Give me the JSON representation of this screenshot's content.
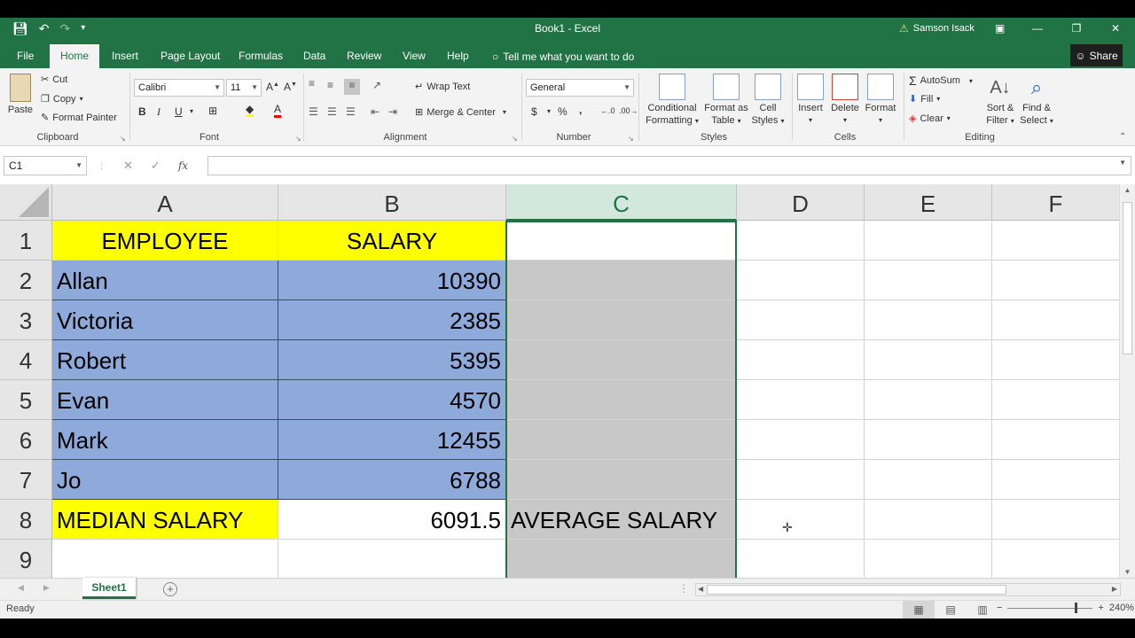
{
  "titlebar": {
    "title": "Book1  -  Excel",
    "user": "Samson Isack"
  },
  "tabs": [
    "File",
    "Home",
    "Insert",
    "Page Layout",
    "Formulas",
    "Data",
    "Review",
    "View",
    "Help"
  ],
  "tell_me": "Tell me what you want to do",
  "share": "Share",
  "ribbon": {
    "clipboard": {
      "paste": "Paste",
      "cut": "Cut",
      "copy": "Copy",
      "format_painter": "Format Painter",
      "label": "Clipboard"
    },
    "font": {
      "name": "Calibri",
      "size": "11",
      "bold": "B",
      "italic": "I",
      "underline": "U",
      "label": "Font"
    },
    "alignment": {
      "wrap": "Wrap Text",
      "merge": "Merge & Center",
      "label": "Alignment"
    },
    "number": {
      "format": "General",
      "currency": "$",
      "percent": "%",
      "comma": ",",
      "label": "Number"
    },
    "styles": {
      "conditional": "Conditional",
      "conditional2": "Formatting",
      "format_table": "Format as",
      "format_table2": "Table",
      "cell_styles": "Cell",
      "cell_styles2": "Styles",
      "label": "Styles"
    },
    "cells": {
      "insert": "Insert",
      "delete": "Delete",
      "format": "Format",
      "label": "Cells"
    },
    "editing": {
      "autosum": "AutoSum",
      "fill": "Fill",
      "clear": "Clear",
      "sort": "Sort &",
      "sort2": "Filter",
      "find": "Find &",
      "find2": "Select",
      "label": "Editing"
    }
  },
  "formula_bar": {
    "name_box": "C1",
    "fx": "fx",
    "content": ""
  },
  "columns": [
    "A",
    "B",
    "C",
    "D",
    "E",
    "F"
  ],
  "rows": [
    "1",
    "2",
    "3",
    "4",
    "5",
    "6",
    "7",
    "8",
    "9"
  ],
  "cells": {
    "A1": "EMPLOYEE",
    "B1": "SALARY",
    "A2": "Allan",
    "B2": "10390",
    "A3": "Victoria",
    "B3": "2385",
    "A4": "Robert",
    "B4": "5395",
    "A5": "Evan",
    "B5": "4570",
    "A6": "Mark",
    "B6": "12455",
    "A7": "Jo",
    "B7": "6788",
    "A8": "MEDIAN SALARY",
    "B8": "6091.5",
    "C8": "AVERAGE SALARY"
  },
  "sheet_tab": "Sheet1",
  "status": {
    "ready": "Ready",
    "zoom": "240%"
  },
  "colors": {
    "excel_green": "#217346",
    "header_yellow": "#ffff00",
    "data_blue": "#8eaadb",
    "selection_grey": "#c8c8c8"
  }
}
